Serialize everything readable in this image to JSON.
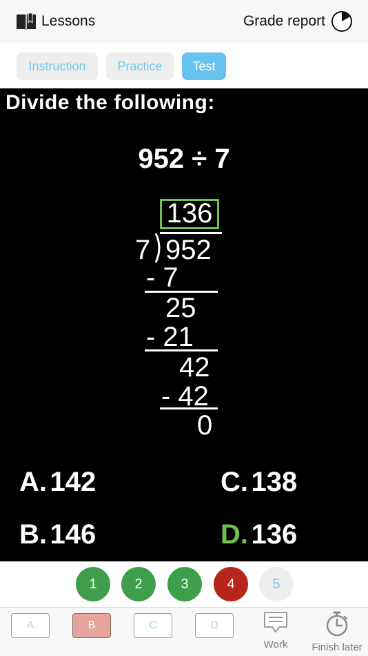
{
  "header": {
    "lessons_label": "Lessons",
    "grade_report_label": "Grade report",
    "lessons_icon": "book-icon",
    "grade_icon": "pie-progress-icon"
  },
  "tabs": [
    {
      "label": "Instruction",
      "active": false
    },
    {
      "label": "Practice",
      "active": false
    },
    {
      "label": "Test",
      "active": true
    }
  ],
  "problem": {
    "prompt": "Divide the following:",
    "equation": "952 ÷ 7",
    "quotient": "136",
    "divisor": "7",
    "dividend": "952",
    "steps": [
      "- 7",
      "25",
      "- 21",
      "42",
      "- 42",
      "0"
    ],
    "choices": [
      {
        "letter": "A.",
        "value": "142"
      },
      {
        "letter": "C.",
        "value": "138"
      },
      {
        "letter": "B.",
        "value": "146"
      },
      {
        "letter": "D.",
        "value": "136",
        "correct": true
      }
    ]
  },
  "progress": {
    "questions": [
      {
        "label": "1",
        "status": "correct"
      },
      {
        "label": "2",
        "status": "correct"
      },
      {
        "label": "3",
        "status": "correct"
      },
      {
        "label": "4",
        "status": "incorrect"
      },
      {
        "label": "5",
        "status": "unanswered"
      }
    ]
  },
  "answers": {
    "buttons": [
      {
        "label": "A",
        "selected": false
      },
      {
        "label": "B",
        "selected": true
      },
      {
        "label": "C",
        "selected": false
      },
      {
        "label": "D",
        "selected": false
      }
    ],
    "work_label": "Work",
    "finish_label": "Finish later"
  },
  "colors": {
    "accent_blue": "#66c2ee",
    "correct_green": "#3e9e4b",
    "incorrect_red": "#b8251d",
    "highlight_green": "#6cc24a",
    "selected_answer": "#e5a49c"
  }
}
